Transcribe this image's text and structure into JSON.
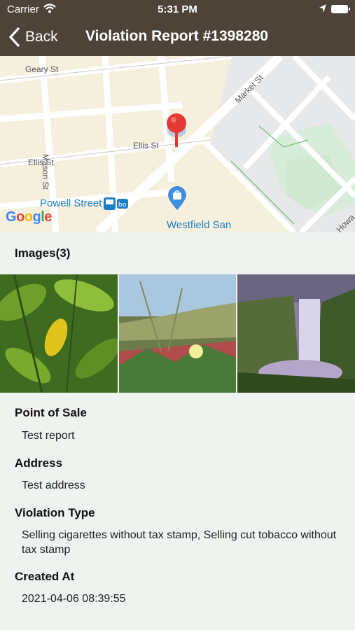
{
  "status_bar": {
    "carrier": "Carrier",
    "time": "5:31 PM"
  },
  "nav": {
    "back_label": "Back",
    "title": "Violation Report #1398280"
  },
  "map": {
    "streets": {
      "geary": "Geary St",
      "ellis_right": "Ellis St",
      "ellis_left": "Ellis St",
      "mason": "Mason St",
      "market": "Market St",
      "howard": "Howa"
    },
    "pois": {
      "powell": "Powell Street",
      "westfield": "Westfield San"
    },
    "attribution": "Google"
  },
  "images": {
    "title": "Images(3)",
    "count": 3
  },
  "details": {
    "point_of_sale": {
      "label": "Point of Sale",
      "value": "Test report"
    },
    "address": {
      "label": "Address",
      "value": "Test address"
    },
    "violation_type": {
      "label": "Violation Type",
      "value": "Selling cigarettes without tax stamp, Selling cut tobacco without tax stamp"
    },
    "created_at": {
      "label": "Created At",
      "value": "2021-04-06 08:39:55"
    }
  },
  "colors": {
    "nav_bg": "#4e4338",
    "page_bg": "#eff3ef",
    "pin_red": "#e53935",
    "poi_blue": "#1a7fc4"
  }
}
